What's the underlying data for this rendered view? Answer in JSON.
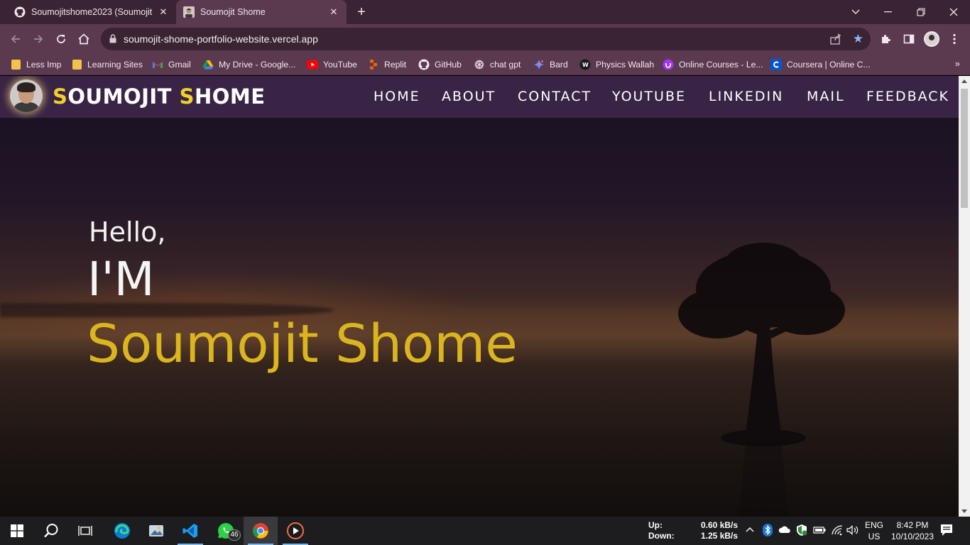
{
  "browser": {
    "tabs": [
      {
        "title": "Soumojitshome2023 (Soumojit S",
        "icon": "github-icon"
      },
      {
        "title": "Soumojit Shome",
        "icon": "profile-photo-icon",
        "active": true
      }
    ],
    "url": "soumojit-shome-portfolio-website.vercel.app",
    "bookmarks": [
      {
        "label": "Less Imp",
        "icon": "folder-icon"
      },
      {
        "label": "Learning Sites",
        "icon": "folder-icon"
      },
      {
        "label": "Gmail",
        "icon": "gmail-icon"
      },
      {
        "label": "My Drive - Google...",
        "icon": "google-drive-icon"
      },
      {
        "label": "YouTube",
        "icon": "youtube-icon"
      },
      {
        "label": "Replit",
        "icon": "replit-icon"
      },
      {
        "label": "GitHub",
        "icon": "github-icon"
      },
      {
        "label": "chat gpt",
        "icon": "chatgpt-icon"
      },
      {
        "label": "Bard",
        "icon": "bard-icon"
      },
      {
        "label": "Physics Wallah",
        "icon": "physics-wallah-icon"
      },
      {
        "label": "Online Courses - Le...",
        "icon": "udemy-icon"
      },
      {
        "label": "Coursera | Online C...",
        "icon": "coursera-icon"
      }
    ],
    "more_bookmarks": "»"
  },
  "site": {
    "logo_first_initial": "S",
    "logo_first_rest": "OUMOJIT ",
    "logo_second_initial": "S",
    "logo_second_rest": "HOME",
    "nav": [
      "HOME",
      "ABOUT",
      "CONTACT",
      "YOUTUBE",
      "LINKEDIN",
      "MAIL",
      "FEEDBACK"
    ],
    "hero": {
      "greeting": "Hello,",
      "intro": "I'M",
      "name": "Soumojit Shome"
    },
    "colors": {
      "accent": "#dab520",
      "header_bg": "#3a2446"
    }
  },
  "taskbar": {
    "apps": [
      "windows-start-icon",
      "search-icon",
      "task-view-icon",
      "edge-icon",
      "photos-icon",
      "vscode-icon",
      "whatsapp-icon",
      "chrome-icon",
      "media-player-icon"
    ],
    "whatsapp_badge": "46",
    "net_up_label": "Up:",
    "net_down_label": "Down:",
    "net_up_value": "0.60 kB/s",
    "net_down_value": "1.25 kB/s",
    "lang_top": "ENG",
    "lang_bottom": "US",
    "time": "8:42 PM",
    "date": "10/10/2023"
  }
}
